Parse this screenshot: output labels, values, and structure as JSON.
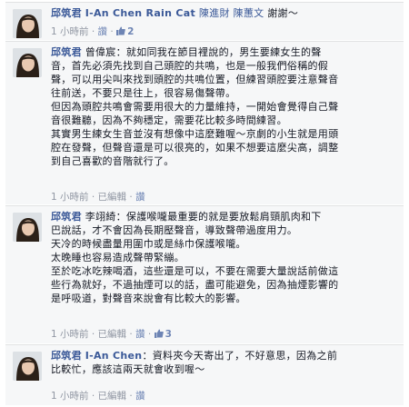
{
  "comments": [
    {
      "author": "邱筑君",
      "parts": [
        {
          "t": " ",
          "c": "plain"
        },
        {
          "t": "I-An Chen Rain Cat",
          "c": "mention-bold"
        },
        {
          "t": " ",
          "c": "plain"
        },
        {
          "t": "陳進財",
          "c": "mention"
        },
        {
          "t": " ",
          "c": "plain"
        },
        {
          "t": "陳蕙文",
          "c": "mention"
        },
        {
          "t": " 謝謝～",
          "c": "plain"
        }
      ],
      "time": "1 小時前",
      "like_label": "讚",
      "like_count": "2",
      "edited": ""
    },
    {
      "author": "邱筑君",
      "lines": [
        "曾偉宸：就如同我在節目裡說的，男生要練女生的聲",
        "音，首先必須先找到自己頭腔的共鳴，也是一般我們俗稱的假",
        "聲，可以用尖叫來找到頭腔的共鳴位置，但練習頭腔要注意聲音",
        "往前送，不要只是往上，很容易傷聲帶。",
        "但因為頭腔共鳴會需要用很大的力量維持，一開始會覺得自己聲",
        "音很難聽，因為不夠穩定，需要花比較多時間練習。",
        "其實男生練女生音並沒有想像中這麼難喔～京劇的小生就是用頭",
        "腔在發聲，但聲音還是可以很亮的，如果不想要這麼尖高，調整",
        "到自己喜歡的音階就行了。"
      ],
      "time": "1 小時前",
      "like_label": "",
      "like_count": "",
      "edited": "已編輯"
    },
    {
      "author": "邱筑君",
      "lines": [
        "李翊綺：保護喉嚨最重要的就是要放鬆肩頸肌肉和下",
        "巴說話，才不會因為長期壓聲音，導致聲帶過度用力。",
        "天冷的時候盡量用圍巾或是絲巾保護喉嚨。",
        "太晚睡也容易造成聲帶緊繃。",
        "至於吃冰吃辣喝酒，這些還是可以，不要在需要大量說話前做這",
        "些行為就好，不過抽煙可以的話，盡可能避免，因為抽煙影響的",
        "是呼吸道，對聲音來說會有比較大的影響。"
      ],
      "time": "1 小時前",
      "like_label": "",
      "like_count": "3",
      "edited": "已編輯"
    },
    {
      "author": "邱筑君",
      "parts": [
        {
          "t": " ",
          "c": "plain"
        },
        {
          "t": "I-An Chen",
          "c": "mention-bold"
        },
        {
          "t": "：資料夾今天寄出了，不好意思，因為之前",
          "c": "plain"
        }
      ],
      "lines": [
        "比較忙，應該這兩天就會收到喔～"
      ],
      "time": "1 小時前",
      "like_label": "",
      "like_count": "",
      "edited": "已編輯"
    }
  ],
  "action_like": "讚",
  "close_glyph": "✕"
}
